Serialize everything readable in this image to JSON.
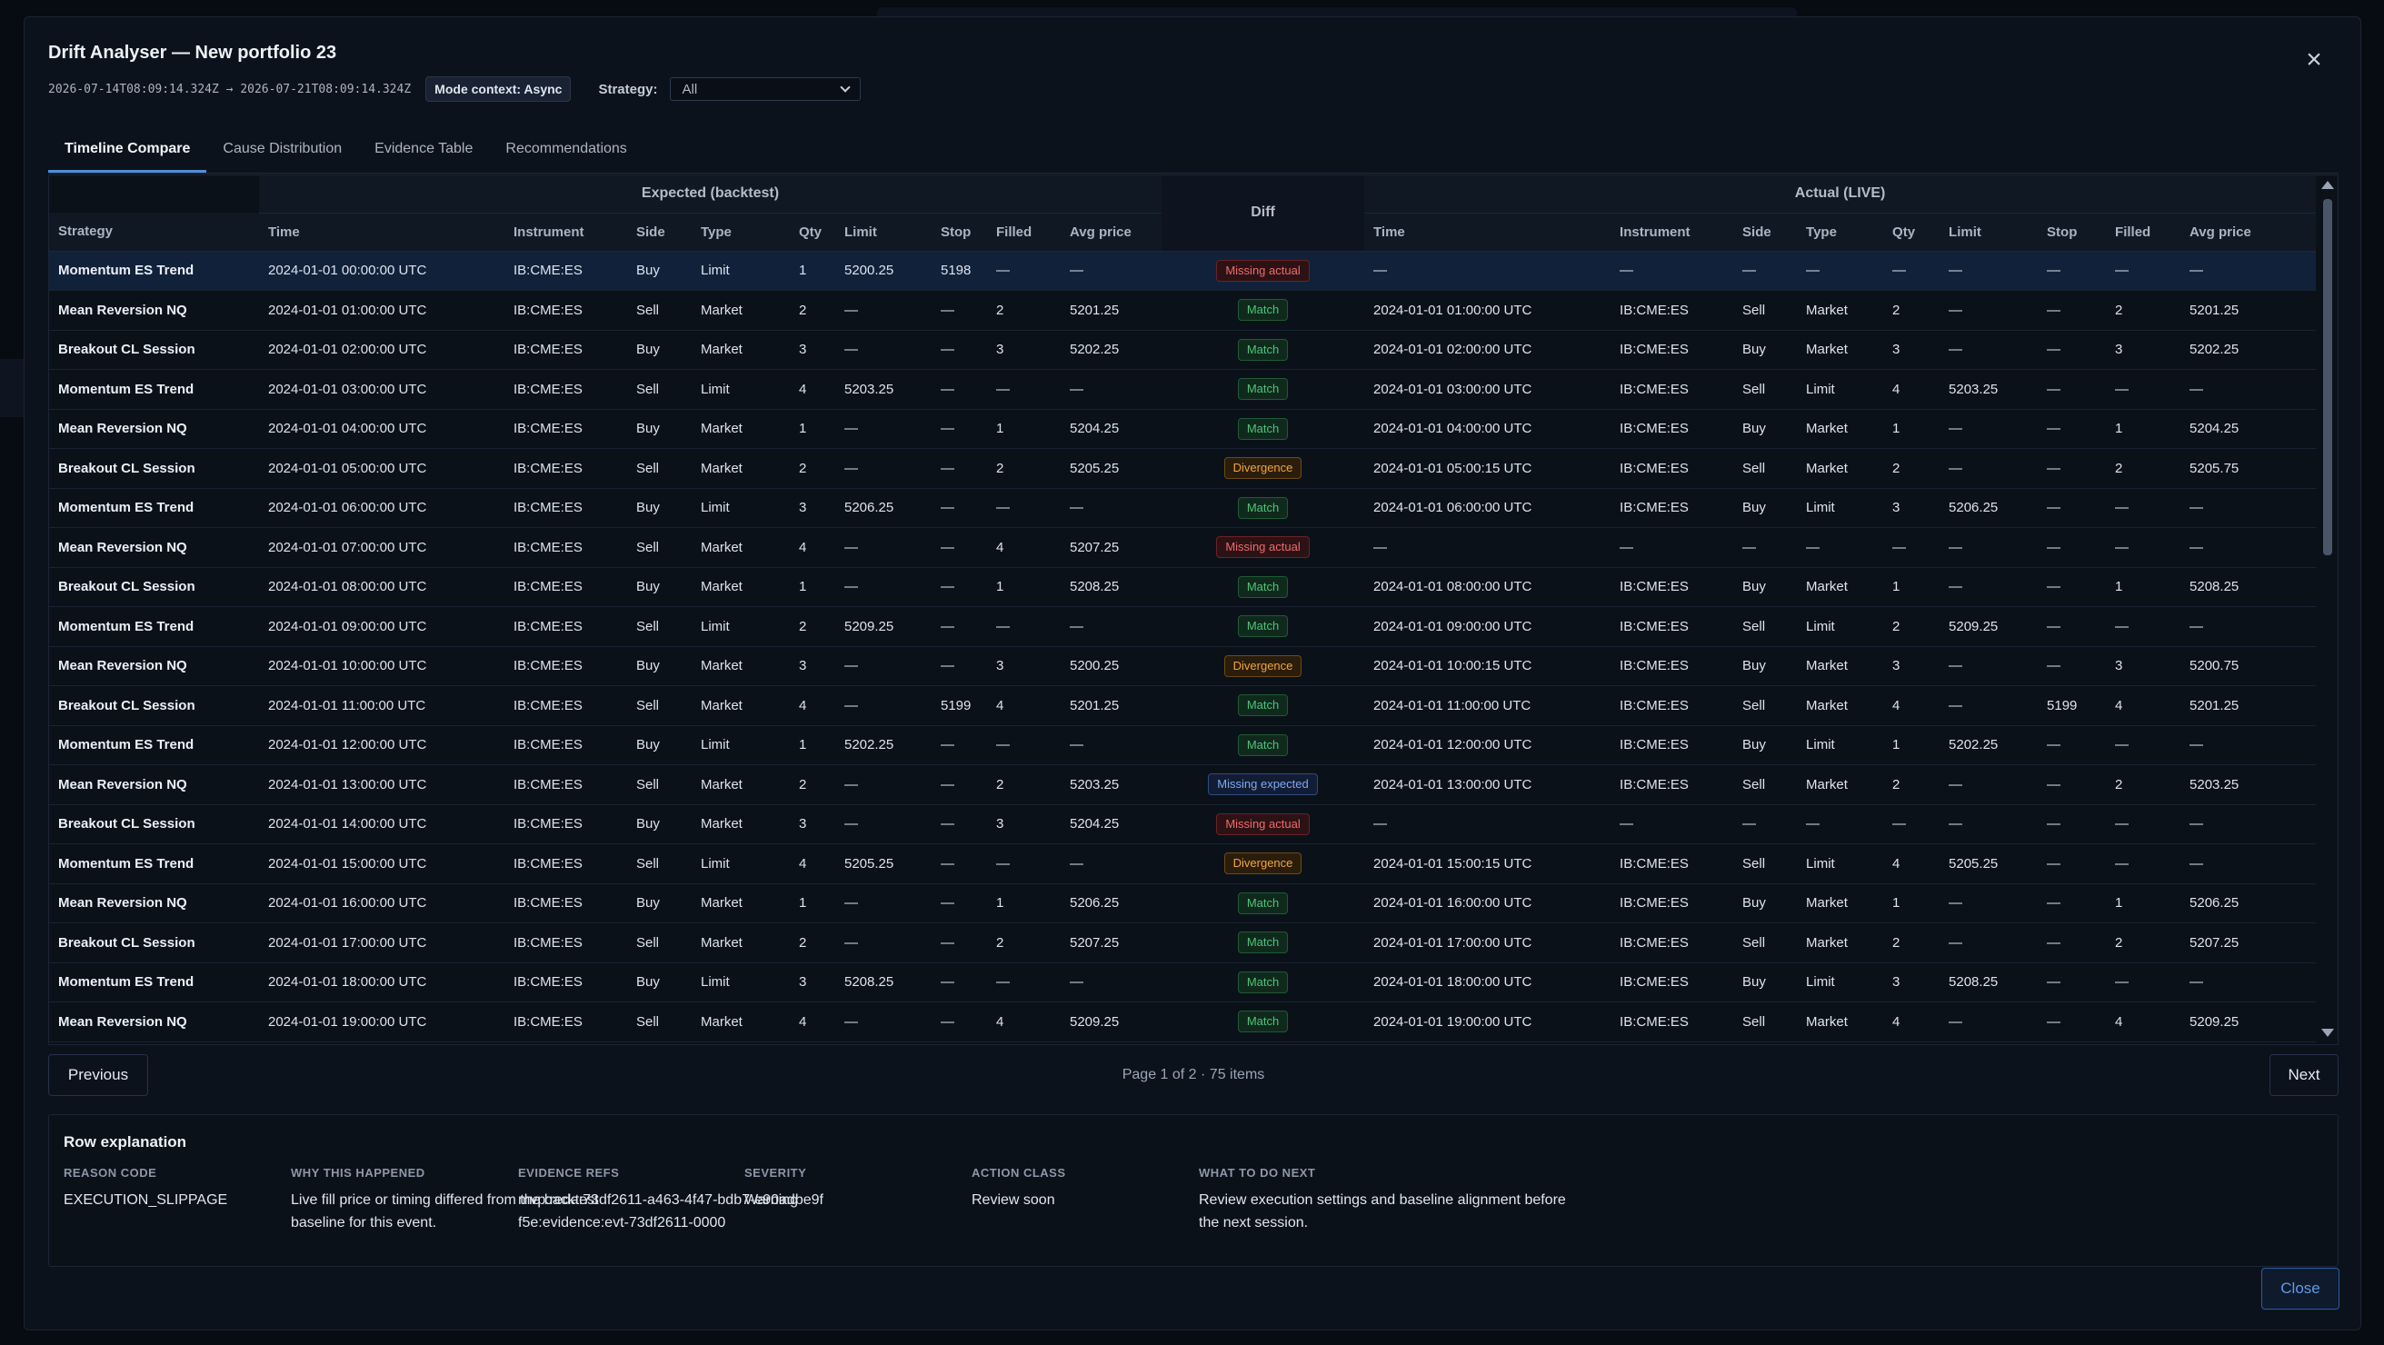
{
  "modal": {
    "title": "Drift Analyser — New portfolio 23",
    "range": "2026-07-14T08:09:14.324Z → 2026-07-21T08:09:14.324Z",
    "mode_badge": "Mode context: Async",
    "strategy_label": "Strategy:",
    "strategy_value": "All",
    "close_label": "Close"
  },
  "tabs": [
    "Timeline Compare",
    "Cause Distribution",
    "Evidence Table",
    "Recommendations"
  ],
  "table": {
    "group_headers": {
      "expected": "Expected (backtest)",
      "diff": "Diff",
      "actual": "Actual (LIVE)"
    },
    "columns": [
      "Strategy",
      "Time",
      "Instrument",
      "Side",
      "Type",
      "Qty",
      "Limit",
      "Stop",
      "Filled",
      "Avg price",
      "Time",
      "Instrument",
      "Side",
      "Type",
      "Qty",
      "Limit",
      "Stop",
      "Filled",
      "Avg price"
    ],
    "rows": [
      {
        "strategy": "Momentum ES Trend",
        "exp": [
          "2024-01-01 00:00:00 UTC",
          "IB:CME:ES",
          "Buy",
          "Limit",
          "1",
          "5200.25",
          "5198",
          "—",
          "—"
        ],
        "diff": "Missing actual",
        "diff_kind": "missing-actual",
        "act": [
          "—",
          "—",
          "—",
          "—",
          "—",
          "—",
          "—",
          "—",
          "—"
        ]
      },
      {
        "strategy": "Mean Reversion NQ",
        "exp": [
          "2024-01-01 01:00:00 UTC",
          "IB:CME:ES",
          "Sell",
          "Market",
          "2",
          "—",
          "—",
          "2",
          "5201.25"
        ],
        "diff": "Match",
        "diff_kind": "match",
        "act": [
          "2024-01-01 01:00:00 UTC",
          "IB:CME:ES",
          "Sell",
          "Market",
          "2",
          "—",
          "—",
          "2",
          "5201.25"
        ]
      },
      {
        "strategy": "Breakout CL Session",
        "exp": [
          "2024-01-01 02:00:00 UTC",
          "IB:CME:ES",
          "Buy",
          "Market",
          "3",
          "—",
          "—",
          "3",
          "5202.25"
        ],
        "diff": "Match",
        "diff_kind": "match",
        "act": [
          "2024-01-01 02:00:00 UTC",
          "IB:CME:ES",
          "Buy",
          "Market",
          "3",
          "—",
          "—",
          "3",
          "5202.25"
        ]
      },
      {
        "strategy": "Momentum ES Trend",
        "exp": [
          "2024-01-01 03:00:00 UTC",
          "IB:CME:ES",
          "Sell",
          "Limit",
          "4",
          "5203.25",
          "—",
          "—",
          "—"
        ],
        "diff": "Match",
        "diff_kind": "match",
        "act": [
          "2024-01-01 03:00:00 UTC",
          "IB:CME:ES",
          "Sell",
          "Limit",
          "4",
          "5203.25",
          "—",
          "—",
          "—"
        ]
      },
      {
        "strategy": "Mean Reversion NQ",
        "exp": [
          "2024-01-01 04:00:00 UTC",
          "IB:CME:ES",
          "Buy",
          "Market",
          "1",
          "—",
          "—",
          "1",
          "5204.25"
        ],
        "diff": "Match",
        "diff_kind": "match",
        "act": [
          "2024-01-01 04:00:00 UTC",
          "IB:CME:ES",
          "Buy",
          "Market",
          "1",
          "—",
          "—",
          "1",
          "5204.25"
        ]
      },
      {
        "strategy": "Breakout CL Session",
        "exp": [
          "2024-01-01 05:00:00 UTC",
          "IB:CME:ES",
          "Sell",
          "Market",
          "2",
          "—",
          "—",
          "2",
          "5205.25"
        ],
        "diff": "Divergence",
        "diff_kind": "divergence",
        "act": [
          "2024-01-01 05:00:15 UTC",
          "IB:CME:ES",
          "Sell",
          "Market",
          "2",
          "—",
          "—",
          "2",
          "5205.75"
        ]
      },
      {
        "strategy": "Momentum ES Trend",
        "exp": [
          "2024-01-01 06:00:00 UTC",
          "IB:CME:ES",
          "Buy",
          "Limit",
          "3",
          "5206.25",
          "—",
          "—",
          "—"
        ],
        "diff": "Match",
        "diff_kind": "match",
        "act": [
          "2024-01-01 06:00:00 UTC",
          "IB:CME:ES",
          "Buy",
          "Limit",
          "3",
          "5206.25",
          "—",
          "—",
          "—"
        ]
      },
      {
        "strategy": "Mean Reversion NQ",
        "exp": [
          "2024-01-01 07:00:00 UTC",
          "IB:CME:ES",
          "Sell",
          "Market",
          "4",
          "—",
          "—",
          "4",
          "5207.25"
        ],
        "diff": "Missing actual",
        "diff_kind": "missing-actual",
        "act": [
          "—",
          "—",
          "—",
          "—",
          "—",
          "—",
          "—",
          "—",
          "—"
        ]
      },
      {
        "strategy": "Breakout CL Session",
        "exp": [
          "2024-01-01 08:00:00 UTC",
          "IB:CME:ES",
          "Buy",
          "Market",
          "1",
          "—",
          "—",
          "1",
          "5208.25"
        ],
        "diff": "Match",
        "diff_kind": "match",
        "act": [
          "2024-01-01 08:00:00 UTC",
          "IB:CME:ES",
          "Buy",
          "Market",
          "1",
          "—",
          "—",
          "1",
          "5208.25"
        ]
      },
      {
        "strategy": "Momentum ES Trend",
        "exp": [
          "2024-01-01 09:00:00 UTC",
          "IB:CME:ES",
          "Sell",
          "Limit",
          "2",
          "5209.25",
          "—",
          "—",
          "—"
        ],
        "diff": "Match",
        "diff_kind": "match",
        "act": [
          "2024-01-01 09:00:00 UTC",
          "IB:CME:ES",
          "Sell",
          "Limit",
          "2",
          "5209.25",
          "—",
          "—",
          "—"
        ]
      },
      {
        "strategy": "Mean Reversion NQ",
        "exp": [
          "2024-01-01 10:00:00 UTC",
          "IB:CME:ES",
          "Buy",
          "Market",
          "3",
          "—",
          "—",
          "3",
          "5200.25"
        ],
        "diff": "Divergence",
        "diff_kind": "divergence",
        "act": [
          "2024-01-01 10:00:15 UTC",
          "IB:CME:ES",
          "Buy",
          "Market",
          "3",
          "—",
          "—",
          "3",
          "5200.75"
        ]
      },
      {
        "strategy": "Breakout CL Session",
        "exp": [
          "2024-01-01 11:00:00 UTC",
          "IB:CME:ES",
          "Sell",
          "Market",
          "4",
          "—",
          "5199",
          "4",
          "5201.25"
        ],
        "diff": "Match",
        "diff_kind": "match",
        "act": [
          "2024-01-01 11:00:00 UTC",
          "IB:CME:ES",
          "Sell",
          "Market",
          "4",
          "—",
          "5199",
          "4",
          "5201.25"
        ]
      },
      {
        "strategy": "Momentum ES Trend",
        "exp": [
          "2024-01-01 12:00:00 UTC",
          "IB:CME:ES",
          "Buy",
          "Limit",
          "1",
          "5202.25",
          "—",
          "—",
          "—"
        ],
        "diff": "Match",
        "diff_kind": "match",
        "act": [
          "2024-01-01 12:00:00 UTC",
          "IB:CME:ES",
          "Buy",
          "Limit",
          "1",
          "5202.25",
          "—",
          "—",
          "—"
        ]
      },
      {
        "strategy": "Mean Reversion NQ",
        "exp": [
          "2024-01-01 13:00:00 UTC",
          "IB:CME:ES",
          "Sell",
          "Market",
          "2",
          "—",
          "—",
          "2",
          "5203.25"
        ],
        "diff": "Missing expected",
        "diff_kind": "missing-expected",
        "act": [
          "2024-01-01 13:00:00 UTC",
          "IB:CME:ES",
          "Sell",
          "Market",
          "2",
          "—",
          "—",
          "2",
          "5203.25"
        ]
      },
      {
        "strategy": "Breakout CL Session",
        "exp": [
          "2024-01-01 14:00:00 UTC",
          "IB:CME:ES",
          "Buy",
          "Market",
          "3",
          "—",
          "—",
          "3",
          "5204.25"
        ],
        "diff": "Missing actual",
        "diff_kind": "missing-actual",
        "act": [
          "—",
          "—",
          "—",
          "—",
          "—",
          "—",
          "—",
          "—",
          "—"
        ]
      },
      {
        "strategy": "Momentum ES Trend",
        "exp": [
          "2024-01-01 15:00:00 UTC",
          "IB:CME:ES",
          "Sell",
          "Limit",
          "4",
          "5205.25",
          "—",
          "—",
          "—"
        ],
        "diff": "Divergence",
        "diff_kind": "divergence",
        "act": [
          "2024-01-01 15:00:15 UTC",
          "IB:CME:ES",
          "Sell",
          "Limit",
          "4",
          "5205.25",
          "—",
          "—",
          "—"
        ]
      },
      {
        "strategy": "Mean Reversion NQ",
        "exp": [
          "2024-01-01 16:00:00 UTC",
          "IB:CME:ES",
          "Buy",
          "Market",
          "1",
          "—",
          "—",
          "1",
          "5206.25"
        ],
        "diff": "Match",
        "diff_kind": "match",
        "act": [
          "2024-01-01 16:00:00 UTC",
          "IB:CME:ES",
          "Buy",
          "Market",
          "1",
          "—",
          "—",
          "1",
          "5206.25"
        ]
      },
      {
        "strategy": "Breakout CL Session",
        "exp": [
          "2024-01-01 17:00:00 UTC",
          "IB:CME:ES",
          "Sell",
          "Market",
          "2",
          "—",
          "—",
          "2",
          "5207.25"
        ],
        "diff": "Match",
        "diff_kind": "match",
        "act": [
          "2024-01-01 17:00:00 UTC",
          "IB:CME:ES",
          "Sell",
          "Market",
          "2",
          "—",
          "—",
          "2",
          "5207.25"
        ]
      },
      {
        "strategy": "Momentum ES Trend",
        "exp": [
          "2024-01-01 18:00:00 UTC",
          "IB:CME:ES",
          "Buy",
          "Limit",
          "3",
          "5208.25",
          "—",
          "—",
          "—"
        ],
        "diff": "Match",
        "diff_kind": "match",
        "act": [
          "2024-01-01 18:00:00 UTC",
          "IB:CME:ES",
          "Buy",
          "Limit",
          "3",
          "5208.25",
          "—",
          "—",
          "—"
        ]
      },
      {
        "strategy": "Mean Reversion NQ",
        "exp": [
          "2024-01-01 19:00:00 UTC",
          "IB:CME:ES",
          "Sell",
          "Market",
          "4",
          "—",
          "—",
          "4",
          "5209.25"
        ],
        "diff": "Match",
        "diff_kind": "match",
        "act": [
          "2024-01-01 19:00:00 UTC",
          "IB:CME:ES",
          "Sell",
          "Market",
          "4",
          "—",
          "—",
          "4",
          "5209.25"
        ]
      }
    ]
  },
  "pager": {
    "prev_label": "Previous",
    "next_label": "Next",
    "info": "Page 1 of 2 · 75 items"
  },
  "explanation": {
    "title": "Row explanation",
    "fields": [
      {
        "key": "REASON CODE",
        "value": "EXECUTION_SLIPPAGE"
      },
      {
        "key": "WHY THIS HAPPENED",
        "value": "Live fill price or timing differed from the backtest baseline for this event."
      },
      {
        "key": "EVIDENCE REFS",
        "value": "mvp:reda:73df2611-a463-4f47-bdb7-e90adbe9ff5e:evidence:evt-73df2611-0000"
      },
      {
        "key": "SEVERITY",
        "value": "Warning"
      },
      {
        "key": "ACTION CLASS",
        "value": "Review soon"
      },
      {
        "key": "WHAT TO DO NEXT",
        "value": "Review execution settings and baseline alignment before the next session."
      }
    ]
  },
  "colors": {
    "accent": "#4f8fd8",
    "match": "#4fc27a",
    "missing_actual": "#f06a6a",
    "divergence": "#f0a53c",
    "missing_expected": "#7ea8ef"
  },
  "icons": {
    "close": "close-icon",
    "dropdown": "chevron-down-icon"
  }
}
